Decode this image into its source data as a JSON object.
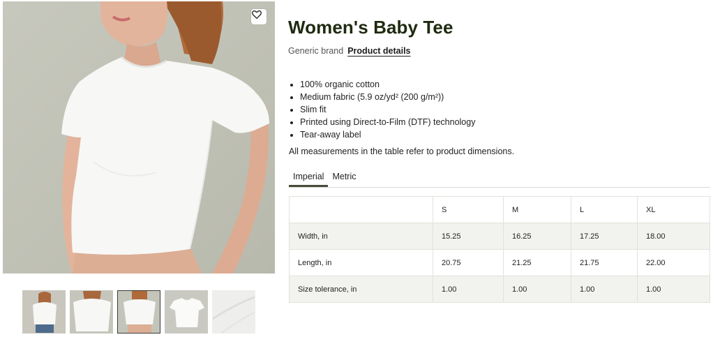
{
  "product": {
    "title": "Women's Baby Tee",
    "brand": "Generic brand",
    "details_link": "Product details"
  },
  "features": [
    "100% organic cotton",
    "Medium fabric (5.9 oz/yd² (200 g/m²))",
    "Slim fit",
    "Printed using Direct-to-Film (DTF) technology",
    "Tear-away label"
  ],
  "measurement_note": "All measurements in the table refer to product dimensions.",
  "tabs": [
    {
      "label": "Imperial",
      "active": true
    },
    {
      "label": "Metric",
      "active": false
    }
  ],
  "size_table": {
    "headers": [
      "",
      "S",
      "M",
      "L",
      "XL"
    ],
    "rows": [
      [
        "Width, in",
        "15.25",
        "16.25",
        "17.25",
        "18.00"
      ],
      [
        "Length, in",
        "20.75",
        "21.25",
        "21.75",
        "22.00"
      ],
      [
        "Size tolerance, in",
        "1.00",
        "1.00",
        "1.00",
        "1.00"
      ]
    ]
  },
  "gallery": {
    "thumbnail_count": 5,
    "active_thumbnail": 2,
    "favorite_icon": "heart-icon"
  },
  "colors": {
    "title": "#1f2a10",
    "background_photo": "#c4c5ba",
    "shaded_row": "#f2f2ee",
    "active_tab_underline": "#4b4b3a"
  }
}
